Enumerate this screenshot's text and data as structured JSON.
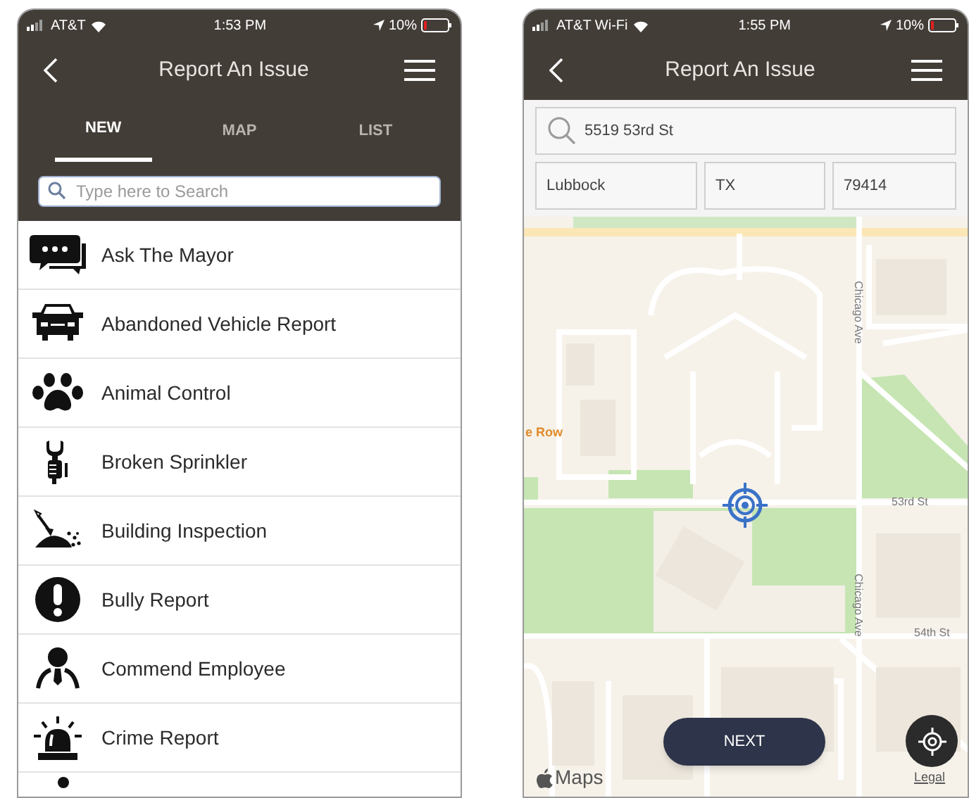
{
  "screens": [
    {
      "status_bar": {
        "carrier": "AT&T",
        "time": "1:53 PM",
        "battery": "10%"
      },
      "header": {
        "title": "Report An Issue"
      },
      "tabs": [
        {
          "label": "NEW",
          "selected": true
        },
        {
          "label": "MAP",
          "selected": false
        },
        {
          "label": "LIST",
          "selected": false
        }
      ],
      "search": {
        "placeholder": "Type here to Search"
      },
      "items": [
        {
          "label": "Ask The Mayor"
        },
        {
          "label": "Abandoned Vehicle Report"
        },
        {
          "label": "Animal Control"
        },
        {
          "label": "Broken Sprinkler"
        },
        {
          "label": "Building Inspection"
        },
        {
          "label": "Bully Report"
        },
        {
          "label": "Commend Employee"
        },
        {
          "label": "Crime Report"
        }
      ]
    },
    {
      "status_bar": {
        "carrier": "AT&T Wi-Fi",
        "time": "1:55 PM",
        "battery": "10%"
      },
      "header": {
        "title": "Report An Issue"
      },
      "address": {
        "street": "5519 53rd St",
        "city": "Lubbock",
        "state": "TX",
        "zip": "79414"
      },
      "map": {
        "labels": [
          "e Row",
          "53rd St",
          "Chicago Ave",
          "Chicago Ave",
          "54th St"
        ],
        "attribution": "Maps",
        "legal": "Legal"
      },
      "next_button": "NEXT"
    }
  ]
}
